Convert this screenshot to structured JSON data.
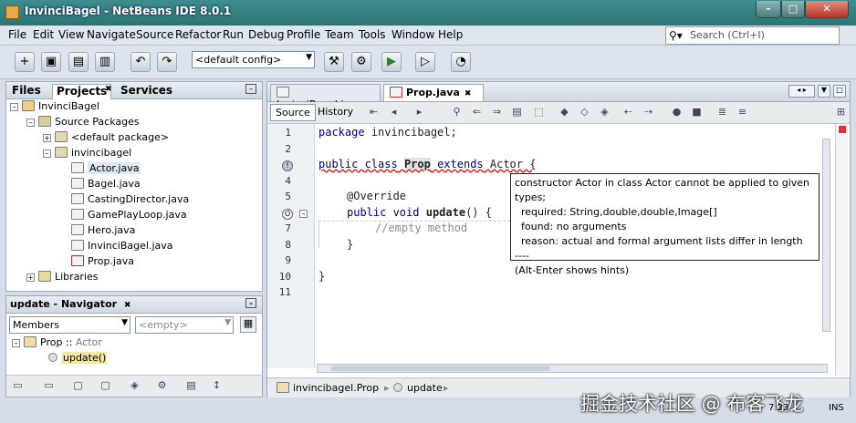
{
  "window": {
    "title": "InvinciBagel - NetBeans IDE 8.0.1",
    "min": "–",
    "max": "□",
    "close": "✕"
  },
  "menu": [
    "File",
    "Edit",
    "View",
    "Navigate",
    "Source",
    "Refactor",
    "Run",
    "Debug",
    "Profile",
    "Team",
    "Tools",
    "Window",
    "Help"
  ],
  "search": {
    "placeholder": "Search (Ctrl+I)"
  },
  "toolbar": {
    "config": "<default config>"
  },
  "projects_panel": {
    "tabs": [
      "Files",
      "Projects",
      "Services"
    ],
    "tree": [
      {
        "label": "InvinciBagel",
        "indent": 0,
        "toggle": "–",
        "icon": "project-icon"
      },
      {
        "label": "Source Packages",
        "indent": 1,
        "toggle": "–",
        "icon": "folder-icon"
      },
      {
        "label": "<default package>",
        "indent": 2,
        "toggle": "+",
        "icon": "package-icon"
      },
      {
        "label": "invincibagel",
        "indent": 2,
        "toggle": "–",
        "icon": "package-icon"
      },
      {
        "label": "Actor.java",
        "indent": 3,
        "icon": "java-file-icon",
        "highlight": true
      },
      {
        "label": "Bagel.java",
        "indent": 3,
        "icon": "java-file-icon"
      },
      {
        "label": "CastingDirector.java",
        "indent": 3,
        "icon": "java-file-icon"
      },
      {
        "label": "GamePlayLoop.java",
        "indent": 3,
        "icon": "java-file-icon"
      },
      {
        "label": "Hero.java",
        "indent": 3,
        "icon": "java-file-icon"
      },
      {
        "label": "InvinciBagel.java",
        "indent": 3,
        "icon": "java-file-icon"
      },
      {
        "label": "Prop.java",
        "indent": 3,
        "icon": "java-file-icon"
      },
      {
        "label": "Libraries",
        "indent": 1,
        "toggle": "+",
        "icon": "library-icon"
      }
    ]
  },
  "navigator": {
    "title": "update - Navigator",
    "members": "Members",
    "filter": "<empty>",
    "class_label": "Prop",
    "class_sep": " :: ",
    "class_parent": "Actor",
    "method": "update()"
  },
  "editor": {
    "tabs": [
      "InvinciBagel.java",
      "Prop.java"
    ],
    "source_tab": "Source",
    "history_tab": "History",
    "line_numbers": [
      "1",
      "2",
      "3",
      "4",
      "5",
      "6",
      "7",
      "8",
      "9",
      "10",
      "11"
    ],
    "lines": {
      "l1_kw": "package",
      "l1_rest": " invincibagel;",
      "l3_kw1": "public class",
      "l3_cls": "Prop",
      "l3_kw2": " extends",
      "l3_rest": " Actor {",
      "l5": "@Override",
      "l6_kw": "public void",
      "l6_method": "update",
      "l6_rest": "() {",
      "l7": "//empty method",
      "l8": "}",
      "l10": "}"
    },
    "breadcrumb": {
      "class": "invincibagel.Prop",
      "method": "update"
    },
    "position": "7:23",
    "mode": "INS"
  },
  "tooltip": {
    "l1": "constructor Actor in class Actor cannot be applied to given types;",
    "l2": "required: String,double,double,Image[]",
    "l3": "found: no arguments",
    "l4": "reason: actual and formal argument lists differ in length",
    "l5": "----",
    "l6": "(Alt-Enter shows hints)"
  },
  "watermark": "掘金技术社区 @ 布客飞龙"
}
